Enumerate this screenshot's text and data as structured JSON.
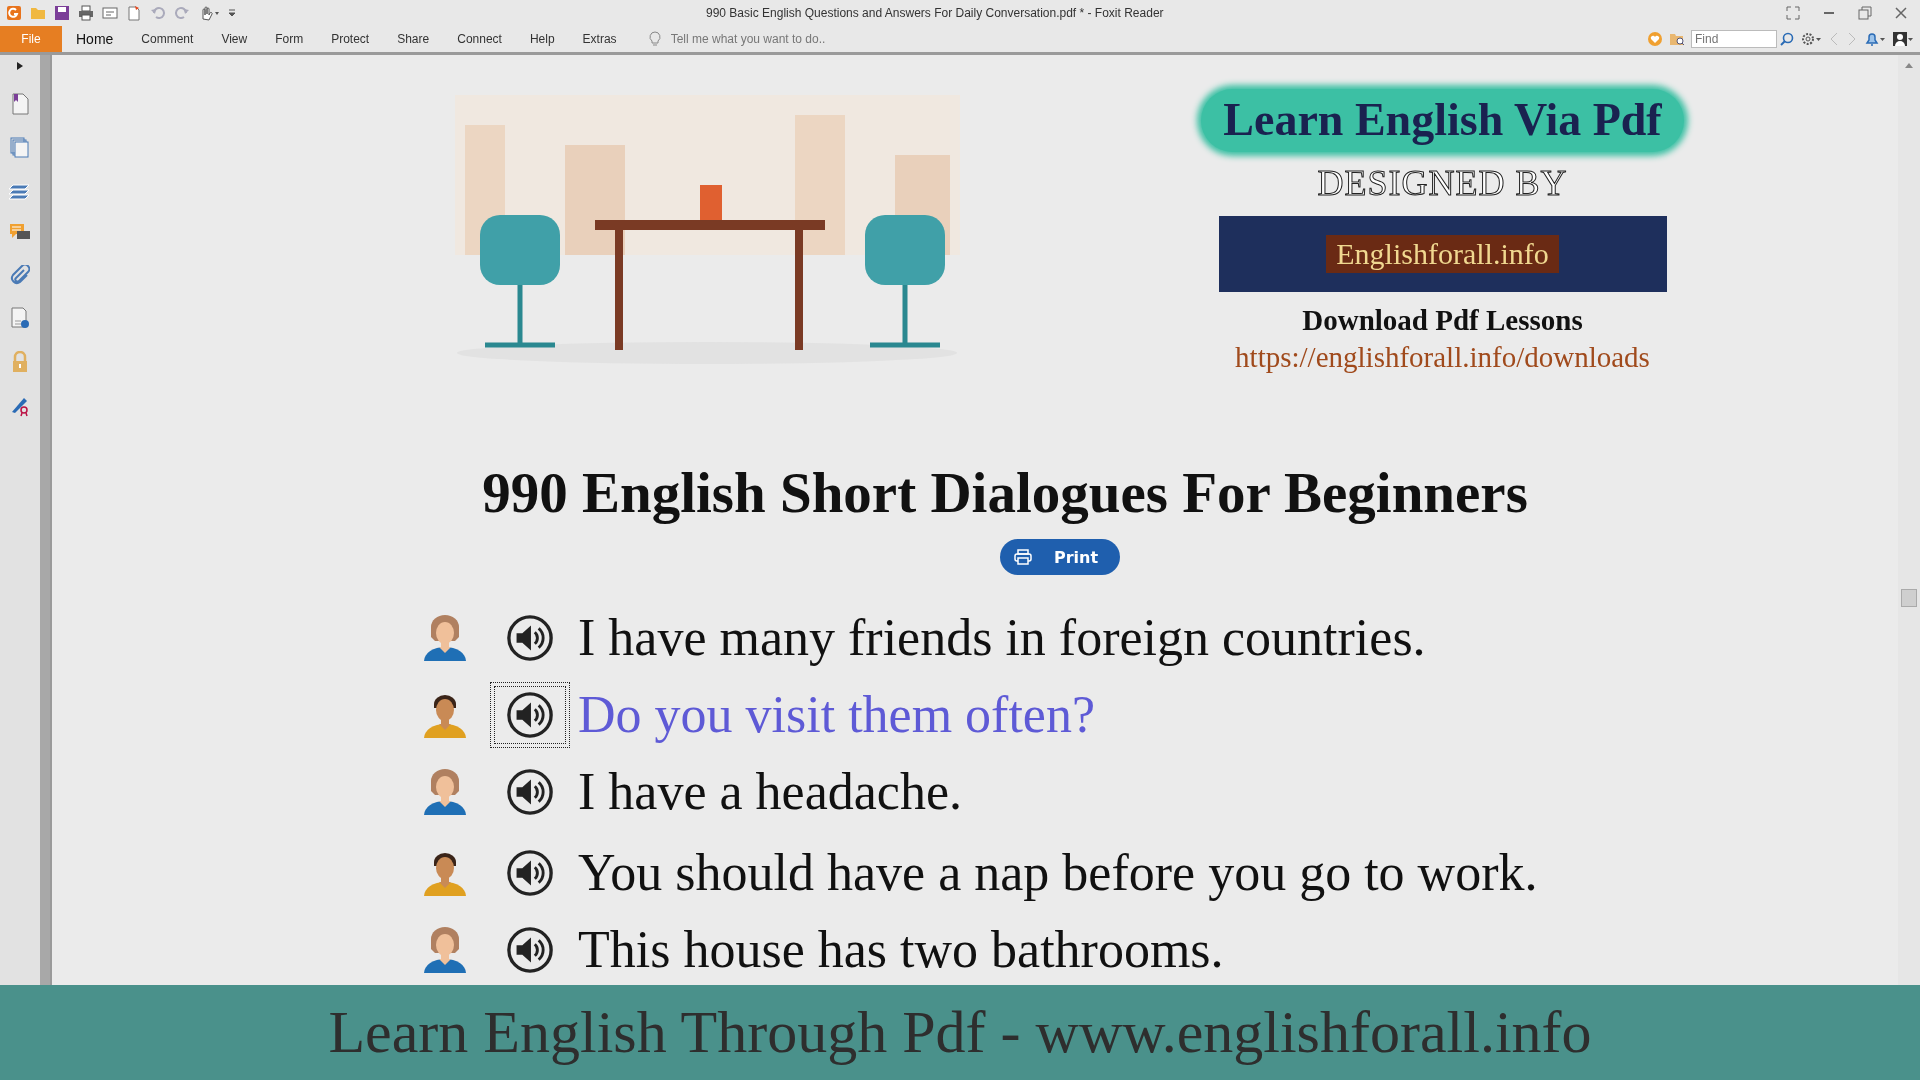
{
  "window": {
    "title": "990 Basic English Questions and Answers For Daily Conversation.pdf * - Foxit Reader"
  },
  "menu": [
    {
      "label": "File",
      "kind": "file",
      "selected": false
    },
    {
      "label": "Home",
      "kind": "tab",
      "selected": true
    },
    {
      "label": "Comment",
      "kind": "tab",
      "selected": false
    },
    {
      "label": "View",
      "kind": "tab",
      "selected": false
    },
    {
      "label": "Form",
      "kind": "tab",
      "selected": false
    },
    {
      "label": "Protect",
      "kind": "tab",
      "selected": false
    },
    {
      "label": "Share",
      "kind": "tab",
      "selected": false
    },
    {
      "label": "Connect",
      "kind": "tab",
      "selected": false
    },
    {
      "label": "Help",
      "kind": "tab",
      "selected": false
    },
    {
      "label": "Extras",
      "kind": "tab",
      "selected": false
    }
  ],
  "tell_me": {
    "placeholder": "Tell me what you want to do.."
  },
  "find": {
    "placeholder": "Find"
  },
  "document": {
    "brand": "Learn English Via Pdf",
    "designed_by": "DESIGNED BY",
    "banner_text": "Englishforall.info",
    "download_label": "Download Pdf Lessons",
    "url": "https://englishforall.info/downloads",
    "title": "990 English Short Dialogues For Beginners",
    "print_button": "Print",
    "lines": [
      {
        "kind": "female",
        "text": "I have many friends in foreign countries.",
        "selected": false
      },
      {
        "kind": "male",
        "text": "Do you visit them often?",
        "selected": true
      },
      {
        "kind": "female",
        "text": "I have a headache.",
        "selected": false
      },
      {
        "kind": "male",
        "text": "You should have a nap before you go to work.",
        "selected": false
      },
      {
        "kind": "female",
        "text": "This house has two bathrooms.",
        "selected": false
      }
    ]
  },
  "footer_banner": "Learn English Through Pdf - www.englishforall.info"
}
